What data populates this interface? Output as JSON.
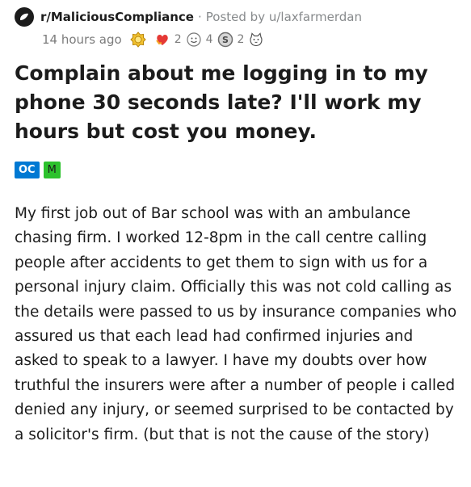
{
  "post": {
    "subreddit": "r/MaliciousCompliance",
    "separator": "·",
    "posted_by": "Posted by u/laxfarmerdan",
    "time": "14 hours ago",
    "awards": [
      {
        "icon": "silver-award-icon",
        "count": ""
      },
      {
        "icon": "heart-hands-award-icon",
        "count": "2"
      },
      {
        "icon": "face-award-icon",
        "count": "4"
      },
      {
        "icon": "coin-award-icon",
        "count": "2"
      },
      {
        "icon": "cat-award-icon",
        "count": ""
      }
    ],
    "title": "Complain about me logging in to my phone 30 seconds late? I'll work my hours but cost you money.",
    "flairs": {
      "oc": "OC",
      "m": "M"
    },
    "body": "My first job out of Bar school was with an ambulance chasing firm. I worked 12-8pm in the call centre calling people after accidents to get them to sign with us for a personal injury claim. Officially this was not cold calling as the details were passed to us by insurance companies who assured us that each lead had confirmed injuries and asked to speak to a lawyer. I have my doubts over how truthful the insurers were after a number of people i called denied any injury, or seemed surprised to be contacted by a solicitor's firm. (but that is not the cause of the story)"
  }
}
